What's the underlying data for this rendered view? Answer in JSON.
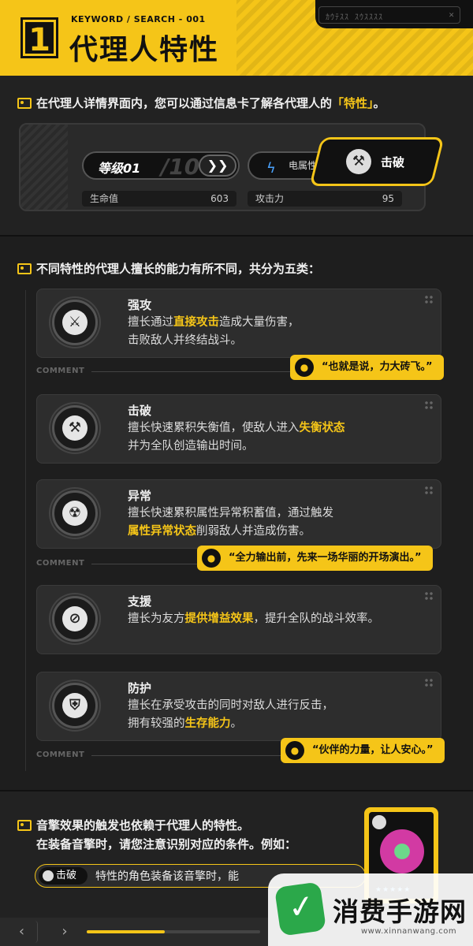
{
  "header": {
    "number": "1",
    "kicker": "KEYWORD / SEARCH - 001",
    "title": "代理人特性",
    "code_text": "ｶｳﾃｽｽ ｽｳｽｽｽｽ",
    "accent": "#f5c518"
  },
  "intro": {
    "text_before": "在代理人详情界面内，您可以通过信息卡了解各代理人的",
    "highlight": "「特性」",
    "text_after": "。"
  },
  "stats_card": {
    "level_label": "等级01",
    "level_cap": "/10",
    "advance_symbol": "❯❯",
    "attribute_label": "电属性",
    "attribute_icon": "lightning-icon",
    "specialty_label": "击破",
    "specialty_icon": "hammer-icon",
    "hp_label": "生命值",
    "hp_value": "603",
    "atk_label": "攻击力",
    "atk_value": "95"
  },
  "traits_intro": "不同特性的代理人擅长的能力有所不同，共分为五类：",
  "comment_label": "COMMENT",
  "traits": [
    {
      "name": "强攻",
      "icon": "crossed-swords-icon",
      "icon_glyph": "⚔",
      "desc_a": "擅长通过",
      "desc_hl": "直接攻击",
      "desc_b": "造成大量伤害，",
      "desc_c": "击败敌人并终结战斗。",
      "quote": "“也就是说，力大砖飞。”"
    },
    {
      "name": "击破",
      "icon": "hammer-icon",
      "icon_glyph": "⚒",
      "desc_a": "擅长快速累积失衡值，使敌人进入",
      "desc_hl": "失衡状态",
      "desc_b": "",
      "desc_c": "并为全队创造输出时间。",
      "quote": ""
    },
    {
      "name": "异常",
      "icon": "radiation-icon",
      "icon_glyph": "☢",
      "desc_a": "擅长快速累积属性异常积蓄值，通过触发",
      "desc_hl": "属性异常状态",
      "desc_b": "削弱敌人并造成伤害。",
      "desc_c": "",
      "quote": "“全力输出前，先来一场华丽的开场演出。”"
    },
    {
      "name": "支援",
      "icon": "support-icon",
      "icon_glyph": "⊘",
      "desc_a": "擅长为友方",
      "desc_hl": "提供增益效果",
      "desc_b": "，提升全队的战斗效率。",
      "desc_c": "",
      "quote": ""
    },
    {
      "name": "防护",
      "icon": "shield-icon",
      "icon_glyph": "⛨",
      "desc_a": "擅长在承受攻击的同时对敌人进行反击，",
      "desc_hl": "生存能力",
      "desc_b": "。",
      "desc_pre": "拥有较强的",
      "desc_c": "",
      "quote": "“伙伴的力量，让人安心。”"
    }
  ],
  "disc_section": {
    "line1": "音擎效果的触发也依赖于代理人的特性。",
    "line2": "在装备音擎时，请您注意识别对应的条件。例如：",
    "chip_label": "击破",
    "chip_icon": "hammer-icon",
    "row_text": "特性的角色装备该音擎时，能",
    "stars": "★★★★★"
  },
  "watermark": {
    "brand": "消费手游网",
    "url": "www.xinnanwang.com"
  },
  "nav": {
    "prev": "‹",
    "next": "›",
    "progress": 0.45
  }
}
